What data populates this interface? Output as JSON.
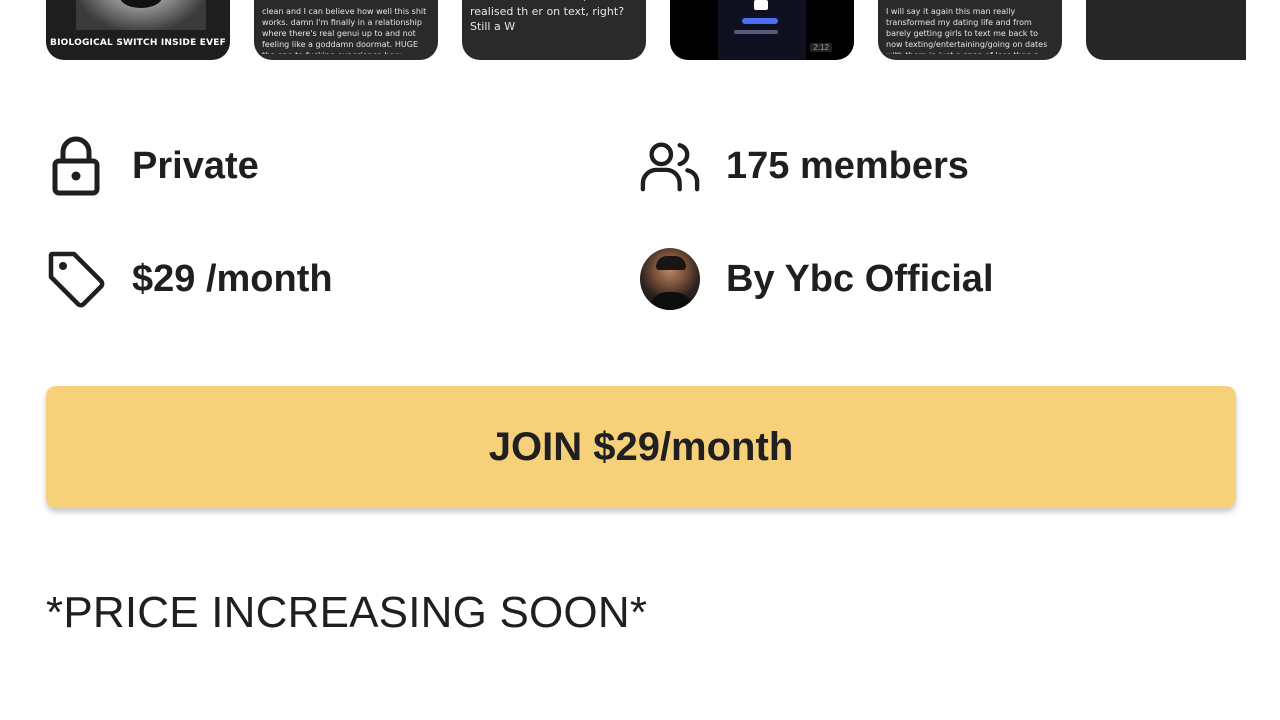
{
  "thumbnails": [
    {
      "caption": "BIOLOGICAL SWITCH INSIDE EVEF",
      "text": ""
    },
    {
      "caption": "",
      "text": "clean and I can believe how well this shit works. damn I'm finally in a relationship where there's real genui up to and not feeling like a goddamn doormat. HUGE tha ope to fucking experience how amazing this feels and co"
    },
    {
      "caption": "",
      "text": "n the interaction tho, I realised th er on text, right? Still a W"
    },
    {
      "caption": "",
      "text": "",
      "duration": "2:12"
    },
    {
      "caption": "",
      "text": "I will say it again this man really transformed my dating life and from barely getting girls to text me back to now texting/entertaining/going on dates with them in just a span of less than a month this is truly magical and if you are not inside yet, you're making a HUGE mistake !"
    },
    {
      "caption": "",
      "text": ""
    }
  ],
  "info": {
    "privacy": "Private",
    "members": "175 members",
    "price": "$29 /month",
    "owner": "By Ybc Official"
  },
  "icons": {
    "privacy": "lock-icon",
    "members": "users-icon",
    "price": "tag-icon",
    "owner": "avatar"
  },
  "join_button": {
    "label": "JOIN $29/month"
  },
  "notice": "*PRICE INCREASING SOON*",
  "colors": {
    "join_button_bg": "#f7d07a",
    "text": "#1f1f1f",
    "thumbnail_bg": "#2a2a2a"
  }
}
